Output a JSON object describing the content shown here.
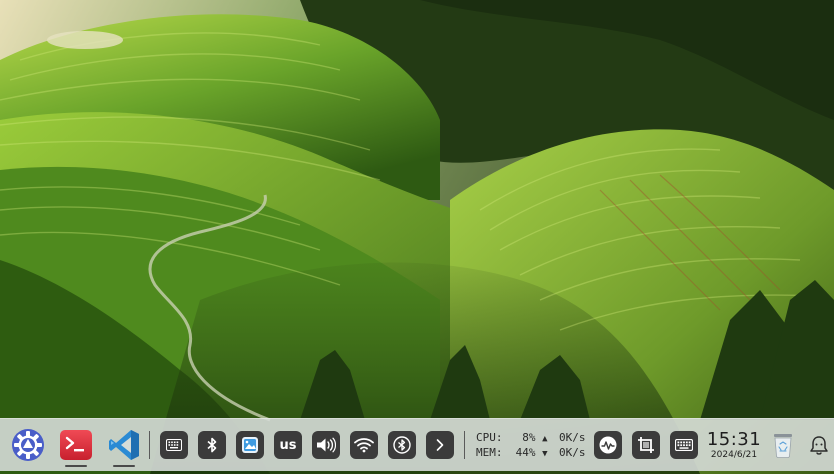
{
  "taskbar": {
    "apps": [
      {
        "id": "launcher",
        "icon": "launcher-gear-icon"
      },
      {
        "id": "terminal",
        "icon": "terminal-icon",
        "running": true
      },
      {
        "id": "vscode",
        "icon": "vscode-icon",
        "running": true
      }
    ],
    "tray": {
      "keyboard_layout": "us",
      "icons": [
        "onscreen-keyboard-icon",
        "bluetooth-icon",
        "screenshot-app-icon",
        "volume-icon",
        "wifi-icon",
        "bluetooth-circle-icon",
        "chevron-right-icon"
      ]
    },
    "system_monitor": {
      "cpu_label": "CPU:",
      "cpu_value": "8%",
      "mem_label": "MEM:",
      "mem_value": "44%",
      "upload_arrow": "▲",
      "download_arrow": "▼",
      "upload_speed": "0K/s",
      "download_speed": "0K/s"
    },
    "clock": {
      "time": "15:31",
      "date": "2024/6/21"
    },
    "right_icons": [
      "activity-monitor-icon",
      "crop-screenshot-icon",
      "keyboard-icon",
      "trash-icon",
      "notification-icon"
    ]
  },
  "colors": {
    "taskbar_bg": "#d6dcd8",
    "tray_button_bg": "#3b3b3b",
    "terminal_red": "#e03340",
    "vscode_blue": "#2a8ad4",
    "launcher_blue": "#4a5ec8"
  }
}
